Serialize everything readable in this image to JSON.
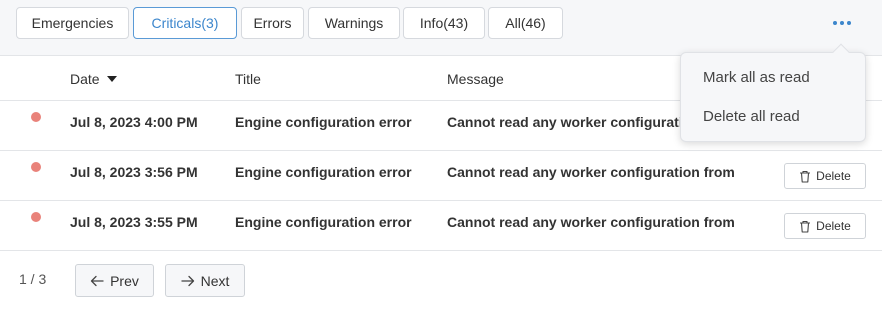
{
  "tabs": [
    {
      "label": "Emergencies"
    },
    {
      "label": "Criticals(3)",
      "active": true
    },
    {
      "label": "Errors"
    },
    {
      "label": "Warnings"
    },
    {
      "label": "Info(43)"
    },
    {
      "label": "All(46)"
    }
  ],
  "more_icon": "ellipsis-icon",
  "table": {
    "headers": {
      "date": "Date",
      "title": "Title",
      "message": "Message"
    },
    "sort": {
      "column": "date",
      "direction": "desc"
    },
    "rows": [
      {
        "date": "Jul 8, 2023 4:00 PM",
        "title": "Engine configuration error",
        "message": "Cannot read any worker configuration from",
        "delete": ""
      },
      {
        "date": "Jul 8, 2023 3:56 PM",
        "title": "Engine configuration error",
        "message": "Cannot read any worker configuration from",
        "delete": "Delete"
      },
      {
        "date": "Jul 8, 2023 3:55 PM",
        "title": "Engine configuration error",
        "message": "Cannot read any worker configuration from",
        "delete": "Delete"
      }
    ],
    "status_dot_color": "#e9827a"
  },
  "pagination": {
    "indicator": "1 / 3",
    "prev": "Prev",
    "next": "Next"
  },
  "menu": {
    "items": [
      "Mark all as read",
      "Delete all read"
    ]
  },
  "colors": {
    "accent": "#3c86cc"
  }
}
